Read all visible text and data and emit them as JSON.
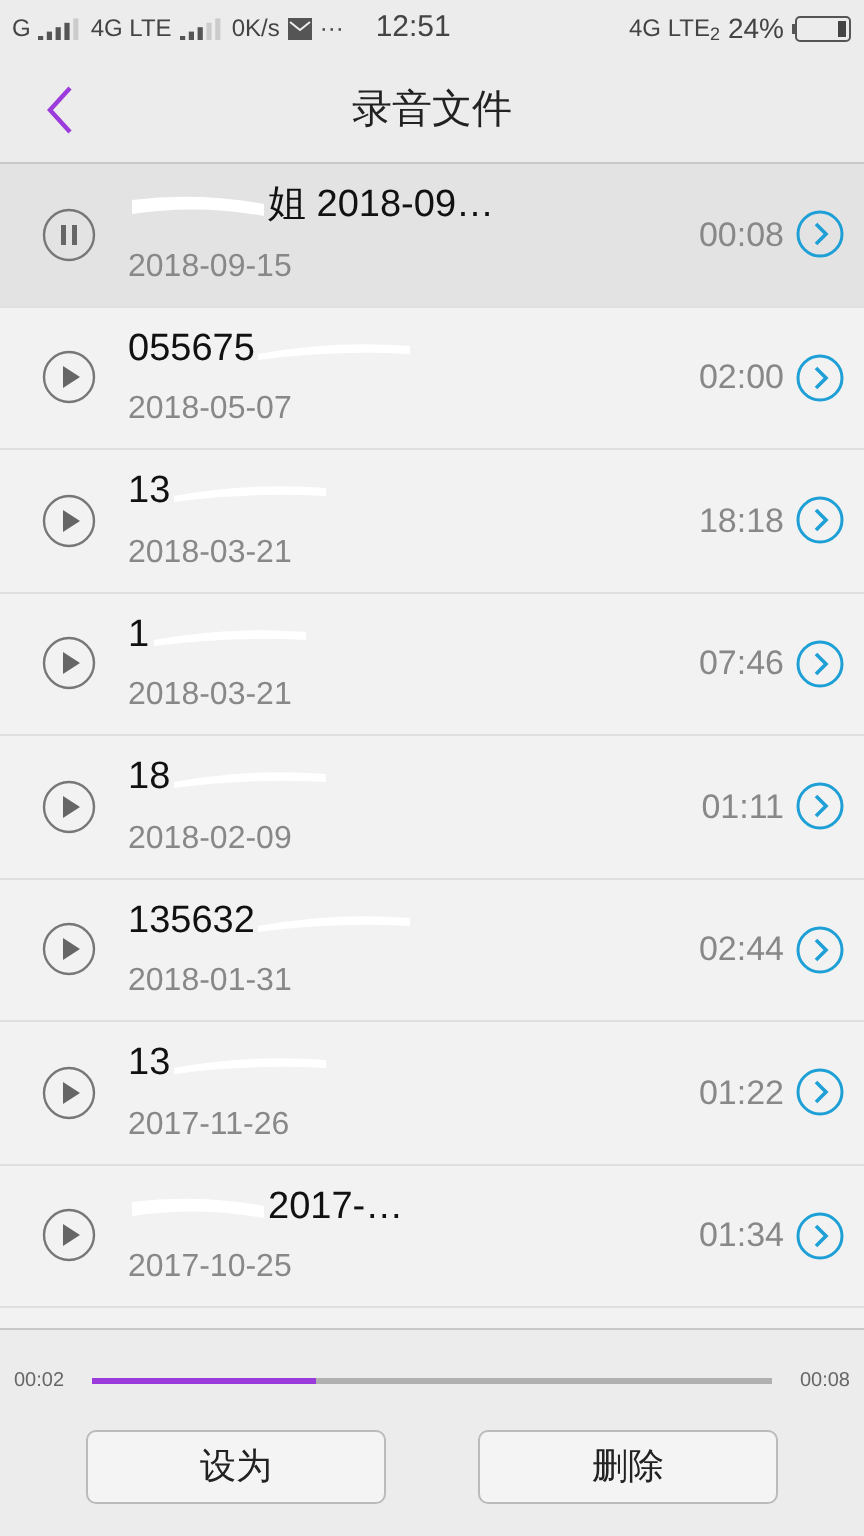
{
  "status_bar": {
    "carrier": "G",
    "network": "4G LTE",
    "speed": "0K/s",
    "more": "···",
    "time": "12:51",
    "network_right": "4G LTE$_{2}$",
    "battery": "24%"
  },
  "header": {
    "title": "录音文件"
  },
  "recordings": [
    {
      "title": "姐 2018-09…",
      "redacted_before": true,
      "date": "2018-09-15",
      "duration": "00:08",
      "playing": true
    },
    {
      "title": "055675",
      "redacted_before": false,
      "date": "2018-05-07",
      "duration": "02:00",
      "playing": false
    },
    {
      "title": "13",
      "redacted_before": false,
      "date": "2018-03-21",
      "duration": "18:18",
      "playing": false
    },
    {
      "title": "1",
      "redacted_before": false,
      "date": "2018-03-21",
      "duration": "07:46",
      "playing": false
    },
    {
      "title": "18",
      "redacted_before": false,
      "date": "2018-02-09",
      "duration": "01:11",
      "playing": false
    },
    {
      "title": "135632",
      "redacted_before": false,
      "date": "2018-01-31",
      "duration": "02:44",
      "playing": false
    },
    {
      "title": "13",
      "redacted_before": false,
      "date": "2017-11-26",
      "duration": "01:22",
      "playing": false
    },
    {
      "title": "2017-…",
      "redacted_before": true,
      "date": "2017-10-25",
      "duration": "01:34",
      "playing": false
    }
  ],
  "player": {
    "elapsed": "00:02",
    "total": "00:08",
    "level": 0.33
  },
  "buttons": [
    "设为",
    "删除"
  ]
}
